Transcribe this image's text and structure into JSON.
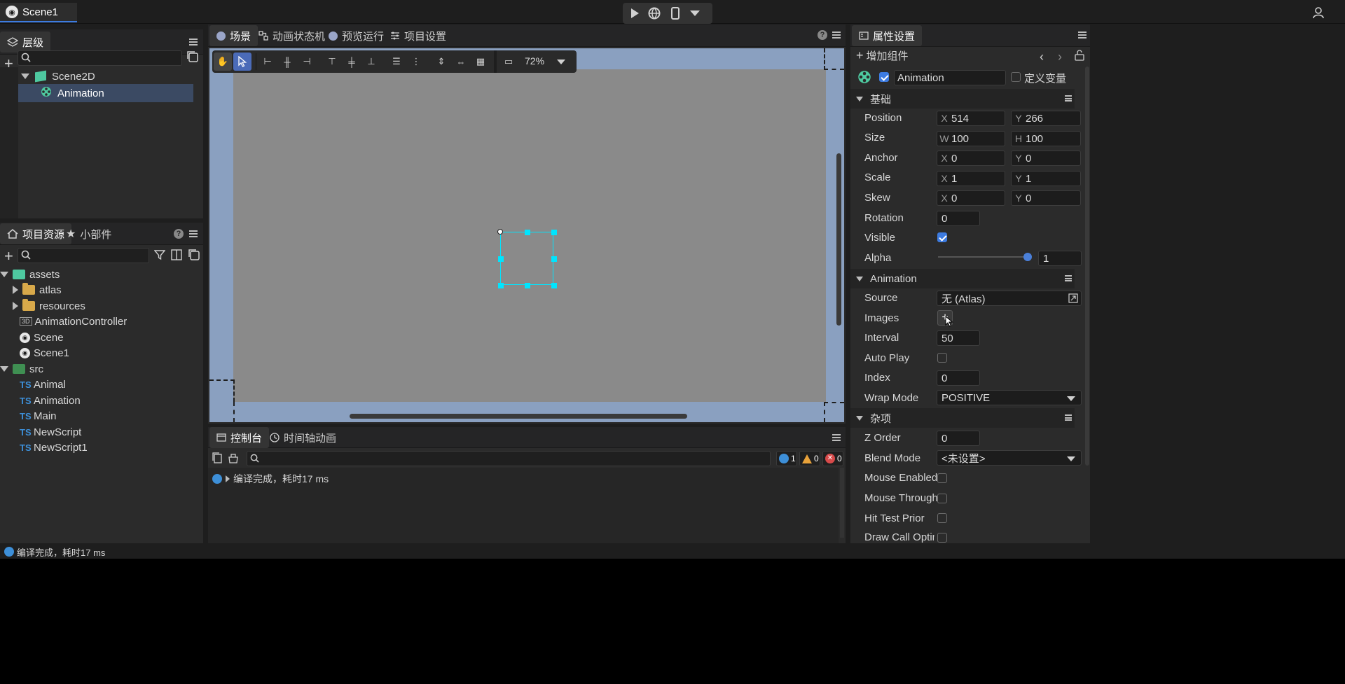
{
  "titlebar": {
    "scene_tab": "Scene1"
  },
  "hierarchy": {
    "tab": "层级",
    "items": [
      {
        "label": "Scene2D"
      },
      {
        "label": "Animation"
      }
    ]
  },
  "assets_panel": {
    "tab_assets": "项目资源",
    "tab_widgets": "小部件",
    "tree": [
      {
        "label": "assets"
      },
      {
        "label": "atlas"
      },
      {
        "label": "resources"
      },
      {
        "label": "AnimationController"
      },
      {
        "label": "Scene"
      },
      {
        "label": "Scene1"
      },
      {
        "label": "src"
      },
      {
        "label": "Animal"
      },
      {
        "label": "Animation"
      },
      {
        "label": "Main"
      },
      {
        "label": "NewScript"
      },
      {
        "label": "NewScript1"
      }
    ],
    "ts_badge": "TS",
    "threed_badge": "3D"
  },
  "center": {
    "tabs": [
      "场景",
      "动画状态机",
      "预览运行",
      "项目设置"
    ],
    "zoom": "72%"
  },
  "console": {
    "tabs": [
      "控制台",
      "时间轴动画"
    ],
    "counts": {
      "info": "1",
      "warn": "0",
      "error": "0"
    },
    "log": "编译完成，耗时17 ms"
  },
  "status_bar": {
    "text": "编译完成，耗时17 ms"
  },
  "inspector": {
    "tab": "属性设置",
    "add_component": "增加组件",
    "node_name": "Animation",
    "define_var": "定义变量",
    "sections": {
      "basic": "基础",
      "animation": "Animation",
      "misc": "杂项"
    },
    "basic": {
      "position": {
        "label": "Position",
        "x": "514",
        "y": "266"
      },
      "size": {
        "label": "Size",
        "w": "100",
        "h": "100"
      },
      "anchor": {
        "label": "Anchor",
        "x": "0",
        "y": "0"
      },
      "scale": {
        "label": "Scale",
        "x": "1",
        "y": "1"
      },
      "skew": {
        "label": "Skew",
        "x": "0",
        "y": "0"
      },
      "rotation": {
        "label": "Rotation",
        "value": "0"
      },
      "visible": {
        "label": "Visible",
        "checked": true
      },
      "alpha": {
        "label": "Alpha",
        "value": "1"
      }
    },
    "animation": {
      "source": {
        "label": "Source",
        "value": "无 (Atlas)"
      },
      "images": {
        "label": "Images"
      },
      "interval": {
        "label": "Interval",
        "value": "50"
      },
      "autoplay": {
        "label": "Auto Play"
      },
      "index": {
        "label": "Index",
        "value": "0"
      },
      "wrapmode": {
        "label": "Wrap Mode",
        "value": "POSITIVE"
      }
    },
    "misc": {
      "zorder": {
        "label": "Z Order",
        "value": "0"
      },
      "blendmode": {
        "label": "Blend Mode",
        "value": "<未设置>"
      },
      "mouse_enabled": {
        "label": "Mouse Enabled"
      },
      "mouse_through": {
        "label": "Mouse Through"
      },
      "hit_test_prior": {
        "label": "Hit Test Prior"
      },
      "draw_call": {
        "label": "Draw Call Optimize"
      }
    },
    "axis": {
      "x": "X",
      "y": "Y",
      "w": "W",
      "h": "H"
    }
  },
  "colors": {
    "accent": "#3d7be0",
    "selection": "#00e5ff",
    "viewport_bg": "#8a8a8a",
    "stage_frame": "#8aa0c0"
  }
}
